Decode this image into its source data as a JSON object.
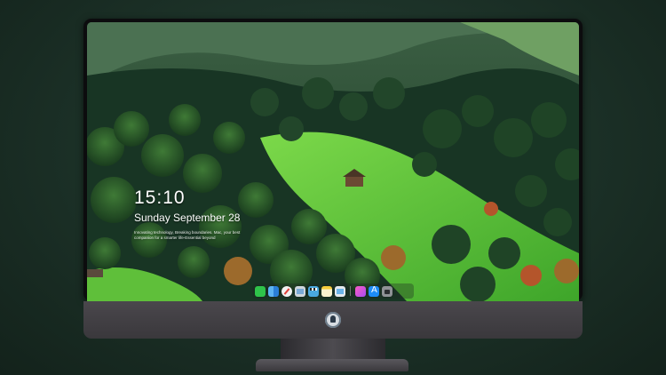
{
  "lockscreen": {
    "time": "15:10",
    "date": "Sunday September 28",
    "tagline": "Innovating technology, Breaking boundaries. Mac, your best companion for a smarter life-Essential beyond"
  },
  "dock": {
    "apps": [
      {
        "name": "messages-icon"
      },
      {
        "name": "finder-icon"
      },
      {
        "name": "safari-icon"
      },
      {
        "name": "files-icon"
      },
      {
        "name": "clapper-icon"
      },
      {
        "name": "notes-icon"
      },
      {
        "name": "preview-icon"
      },
      {
        "name": "music-icon"
      },
      {
        "name": "app-store-icon"
      },
      {
        "name": "camera-icon"
      }
    ]
  },
  "colors": {
    "background": "#1d3329",
    "bezel": "#0c0c0e",
    "chin": "#423f44",
    "text": "#ffffff"
  }
}
